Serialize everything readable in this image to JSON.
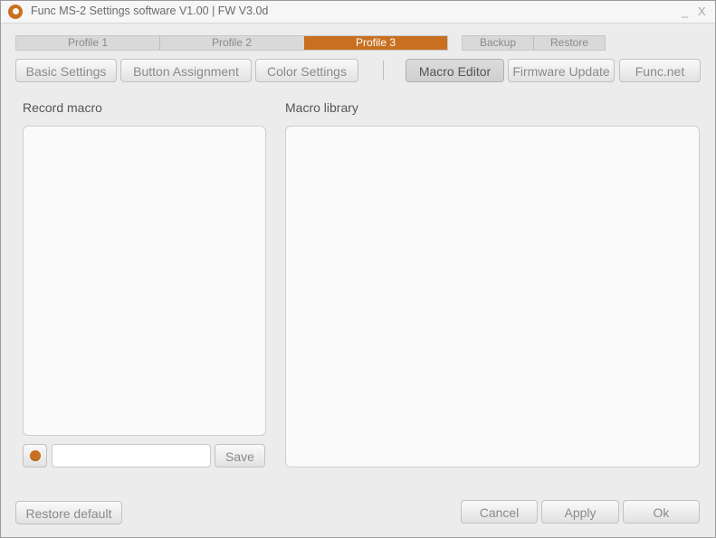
{
  "window": {
    "title": "Func MS-2 Settings software V1.00 | FW V3.0d",
    "minimize": "_",
    "close": "X"
  },
  "profiles": {
    "tabs": [
      "Profile 1",
      "Profile 2",
      "Profile 3"
    ],
    "active": "Profile 3"
  },
  "backup": {
    "backup_label": "Backup",
    "restore_label": "Restore"
  },
  "nav": {
    "basic_settings": "Basic Settings",
    "button_assignment": "Button Assignment",
    "color_settings": "Color Settings",
    "macro_editor": "Macro Editor",
    "firmware_update": "Firmware Update",
    "func_net": "Func.net",
    "active": "Macro Editor"
  },
  "record": {
    "label": "Record macro",
    "name_value": "",
    "save_label": "Save"
  },
  "library": {
    "label": "Macro library"
  },
  "footer": {
    "restore_default": "Restore default",
    "cancel": "Cancel",
    "apply": "Apply",
    "ok": "Ok"
  },
  "colors": {
    "accent": "#c87020",
    "background": "#ececec"
  }
}
